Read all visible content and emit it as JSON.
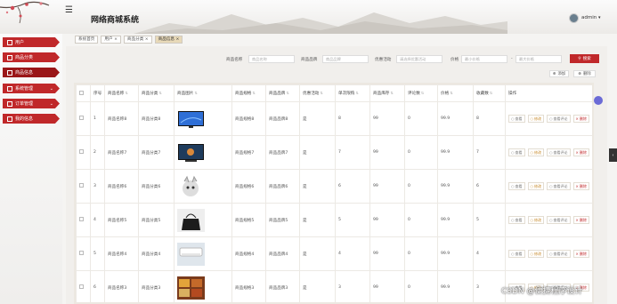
{
  "header": {
    "system_title": "网络商城系统",
    "user_name": "admin",
    "user_caret": "▾",
    "menu_icon": "menu-icon"
  },
  "sidebar": {
    "items": [
      {
        "label": "用户",
        "icon": "grid-icon",
        "active": false,
        "expandable": false
      },
      {
        "label": "商品分类",
        "icon": "folder-icon",
        "active": false,
        "expandable": false
      },
      {
        "label": "商品信息",
        "icon": "flag-icon",
        "active": true,
        "expandable": false
      },
      {
        "label": "系统管理",
        "icon": "grid-icon",
        "active": false,
        "expandable": true
      },
      {
        "label": "订单管理",
        "icon": "grid-icon",
        "active": false,
        "expandable": true
      },
      {
        "label": "我的信息",
        "icon": "grid-icon",
        "active": false,
        "expandable": false
      }
    ]
  },
  "tabs": [
    {
      "label": "系统首页",
      "closable": false,
      "active": false
    },
    {
      "label": "用户",
      "closable": true,
      "active": false
    },
    {
      "label": "商品分类",
      "closable": true,
      "active": false
    },
    {
      "label": "商品信息",
      "closable": true,
      "active": true
    }
  ],
  "search": {
    "fields": [
      {
        "label": "商品名称",
        "placeholder": "商品名称"
      },
      {
        "label": "商品品牌",
        "placeholder": "商品品牌"
      },
      {
        "label": "优惠活动",
        "placeholder": "请选择优惠活动"
      },
      {
        "label": "价格",
        "placeholder": "最小价格"
      },
      {
        "label": "",
        "placeholder": "最大价格"
      }
    ],
    "range_sep": "-",
    "button_label": "搜索"
  },
  "actions": {
    "add_label": "添加",
    "delete_label": "删除"
  },
  "table": {
    "columns": [
      "序号",
      "商品名称",
      "商品分类",
      "商品图片",
      "商品规格",
      "商品品牌",
      "优惠活动",
      "单次限购",
      "商品库存",
      "评论数",
      "价格",
      "收藏数",
      "操作"
    ],
    "rows": [
      {
        "no": "1",
        "name": "商品名称8",
        "category": "商品分类8",
        "spec": "商品规格8",
        "brand": "商品品牌8",
        "promo": "是",
        "limit": "8",
        "stock": "99",
        "comments": "0",
        "price": "99.9",
        "favorites": "8",
        "image": "tv-blue"
      },
      {
        "no": "2",
        "name": "商品名称7",
        "category": "商品分类7",
        "spec": "商品规格7",
        "brand": "商品品牌7",
        "promo": "是",
        "limit": "7",
        "stock": "99",
        "comments": "0",
        "price": "99.9",
        "favorites": "7",
        "image": "tv-dark"
      },
      {
        "no": "3",
        "name": "商品名称6",
        "category": "商品分类6",
        "spec": "商品规格6",
        "brand": "商品品牌6",
        "promo": "是",
        "limit": "6",
        "stock": "99",
        "comments": "0",
        "price": "99.9",
        "favorites": "6",
        "image": "plush-toy"
      },
      {
        "no": "4",
        "name": "商品名称5",
        "category": "商品分类5",
        "spec": "商品规格5",
        "brand": "商品品牌5",
        "promo": "是",
        "limit": "5",
        "stock": "99",
        "comments": "0",
        "price": "99.9",
        "favorites": "5",
        "image": "handbag"
      },
      {
        "no": "5",
        "name": "商品名称4",
        "category": "商品分类4",
        "spec": "商品规格4",
        "brand": "商品品牌4",
        "promo": "是",
        "limit": "4",
        "stock": "99",
        "comments": "0",
        "price": "99.9",
        "favorites": "4",
        "image": "air-conditioner"
      },
      {
        "no": "6",
        "name": "商品名称3",
        "category": "商品分类3",
        "spec": "商品规格3",
        "brand": "商品品牌3",
        "promo": "是",
        "limit": "3",
        "stock": "99",
        "comments": "0",
        "price": "99.9",
        "favorites": "3",
        "image": "snacks"
      }
    ],
    "row_ops": {
      "view": "查看",
      "edit": "修改",
      "review": "查看评论",
      "delete": "删除"
    }
  },
  "watermark": "CSDN @便捷程序设计",
  "colors": {
    "accent": "#c0282a",
    "accent_dark": "#9a1618",
    "edit": "#c88a2a",
    "scroll_dot": "#6b6bd6"
  }
}
